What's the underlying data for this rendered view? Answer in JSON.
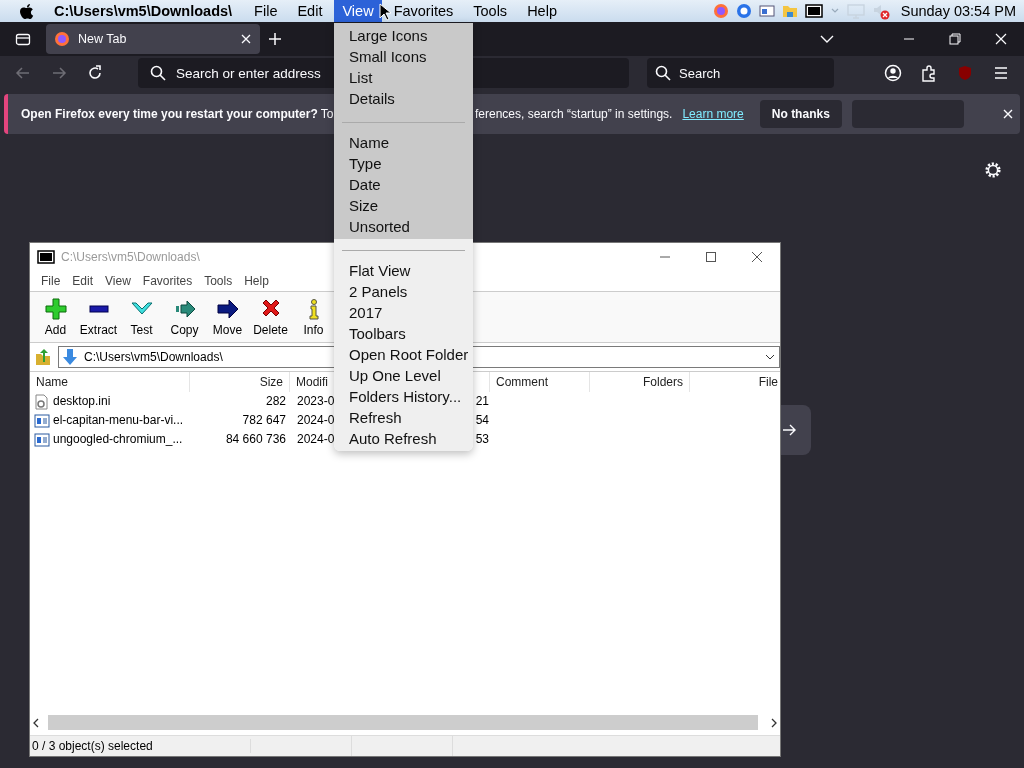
{
  "menubar": {
    "title": "C:\\Users\\vm5\\Downloads\\",
    "menus": [
      {
        "label": "File",
        "selected": false
      },
      {
        "label": "Edit",
        "selected": false
      },
      {
        "label": "View",
        "selected": true
      },
      {
        "label": "Favorites",
        "selected": false
      },
      {
        "label": "Tools",
        "selected": false
      },
      {
        "label": "Help",
        "selected": false
      }
    ],
    "clock": "Sunday 03:54 PM"
  },
  "browser": {
    "tab": {
      "title": "New Tab"
    },
    "address": {
      "placeholder": "Search or enter address"
    },
    "search": {
      "placeholder": "Search"
    },
    "notification": {
      "message": "**Open Firefox every time you restart your computer?** To",
      "message_rest": "ferences, search “startup” in settings.",
      "link": "Learn more",
      "button": "No thanks"
    }
  },
  "archiver": {
    "title": "C:\\Users\\vm5\\Downloads\\",
    "menus": [
      "File",
      "Edit",
      "View",
      "Favorites",
      "Tools",
      "Help"
    ],
    "tools": [
      {
        "label": "Add",
        "kind": "add"
      },
      {
        "label": "Extract",
        "kind": "extract"
      },
      {
        "label": "Test",
        "kind": "test"
      },
      {
        "label": "Copy",
        "kind": "copy"
      },
      {
        "label": "Move",
        "kind": "move"
      },
      {
        "label": "Delete",
        "kind": "delete"
      },
      {
        "label": "Info",
        "kind": "info"
      }
    ],
    "path": "C:\\Users\\vm5\\Downloads\\",
    "columns": [
      "Name",
      "Size",
      "Modifi",
      "Comment",
      "Folders",
      "File"
    ],
    "rows": [
      {
        "name": "desktop.ini",
        "kind": "settings",
        "size": "282",
        "modified": "2023-0",
        "created": "21"
      },
      {
        "name": "el-capitan-menu-bar-vi...",
        "kind": "document",
        "size": "782 647",
        "modified": "2024-0",
        "created": "54"
      },
      {
        "name": "ungoogled-chromium_...",
        "kind": "document",
        "size": "84 660 736",
        "modified": "2024-0",
        "created": "53"
      }
    ],
    "status": "0 / 3 object(s) selected"
  },
  "view_menu": {
    "groups": [
      [
        "Large Icons",
        "Small Icons",
        "List",
        "Details"
      ],
      [
        "Name",
        "Type",
        "Date",
        "Size",
        "Unsorted"
      ],
      [
        "Flat View",
        "2 Panels",
        "2017",
        "Toolbars",
        "Open Root Folder",
        "Up One Level",
        "Folders History...",
        "Refresh",
        "Auto Refresh"
      ]
    ]
  }
}
